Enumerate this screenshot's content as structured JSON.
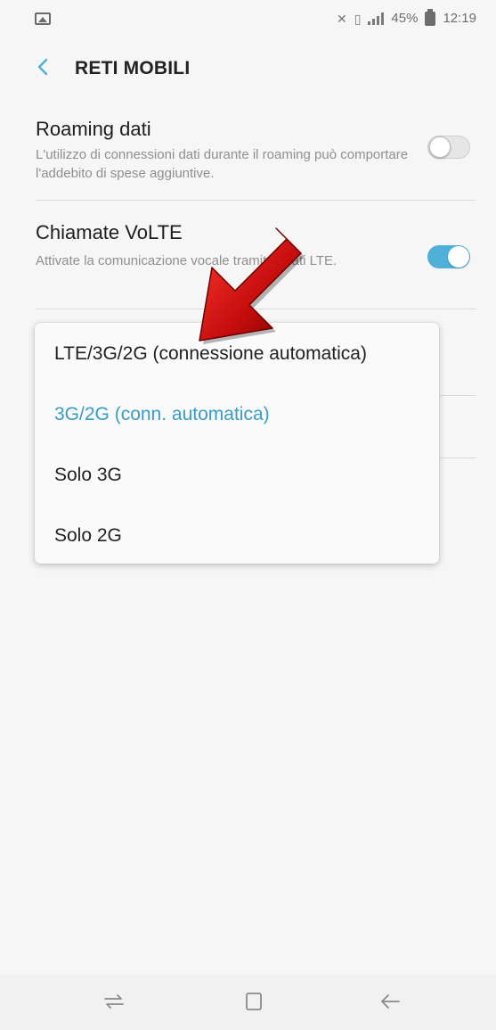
{
  "status_bar": {
    "battery": "45%",
    "time": "12:19",
    "left_icon": "image-notification-icon",
    "icons": [
      "mute-icon",
      "vibrate-icon",
      "signal-icon",
      "battery-icon"
    ]
  },
  "app_bar": {
    "title": "RETI MOBILI",
    "back_icon": "back-chevron-icon",
    "accent_color": "#4fb1d8"
  },
  "settings": [
    {
      "title": "Roaming dati",
      "description": "L'utilizzo di connessioni dati durante il roaming può comportare l'addebito di spese aggiuntive.",
      "toggle": "off"
    },
    {
      "title": "Chiamate VoLTE",
      "description": "Attivate la comunicazione vocale tramite i dati LTE.",
      "toggle": "on"
    }
  ],
  "network_mode_popup": {
    "options": [
      "LTE/3G/2G (connessione automatica)",
      "3G/2G (conn. automatica)",
      "Solo 3G",
      "Solo 2G"
    ],
    "selected_index": 1,
    "selected_color": "#3a9cc6"
  },
  "annotation": {
    "icon": "red-arrow-icon",
    "color": "#d01010"
  },
  "nav_bar": {
    "buttons": [
      "recent-apps-icon",
      "home-icon",
      "back-arrow-icon"
    ]
  }
}
